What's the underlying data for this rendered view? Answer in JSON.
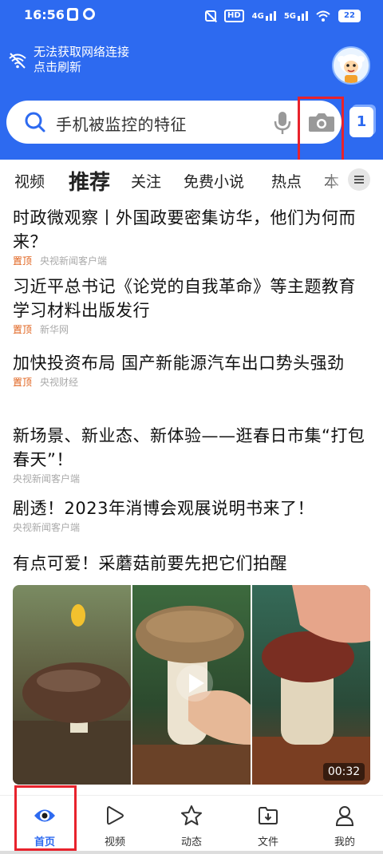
{
  "status_bar": {
    "time": "16:56",
    "network_hd": "HD",
    "signal1": "4G",
    "signal2": "5G",
    "battery": "22"
  },
  "header": {
    "offline_line1": "无法获取网络连接",
    "offline_line2": "点击刷新",
    "accent_color": "#2d6af0"
  },
  "search": {
    "query": "手机被监控的特征",
    "tab_count": "1",
    "icons": [
      "search-icon",
      "mic-icon",
      "camera-icon"
    ]
  },
  "category_tabs": [
    {
      "label": "视频",
      "active": false
    },
    {
      "label": "推荐",
      "active": true
    },
    {
      "label": "关注",
      "active": false
    },
    {
      "label": "免费小说",
      "active": false
    },
    {
      "label": "热点",
      "active": false
    },
    {
      "label": "本",
      "active": false
    }
  ],
  "news": [
    {
      "title": "时政微观察丨外国政要密集访华，他们为何而来？",
      "pinned": "置顶",
      "source": "央视新闻客户端"
    },
    {
      "title": "习近平总书记《论党的自我革命》等主题教育学习材料出版发行",
      "pinned": "置顶",
      "source": "新华网"
    },
    {
      "title": "加快投资布局 国产新能源汽车出口势头强劲",
      "pinned": "置顶",
      "source": "央视财经"
    },
    {
      "title": "新场景、新业态、新体验——逛春日市集“打包春天”！",
      "pinned": "",
      "source": "央视新闻客户端"
    },
    {
      "title": "剧透！2023年消博会观展说明书来了！",
      "pinned": "",
      "source": "央视新闻客户端"
    }
  ],
  "video": {
    "title": "有点可爱！采蘑菇前要先把它们拍醒",
    "duration": "00:32"
  },
  "bottom_nav": [
    {
      "label": "首页",
      "icon": "eye-icon",
      "active": true
    },
    {
      "label": "视频",
      "icon": "play-icon",
      "active": false
    },
    {
      "label": "动态",
      "icon": "star-icon",
      "active": false
    },
    {
      "label": "文件",
      "icon": "folder-icon",
      "active": false
    },
    {
      "label": "我的",
      "icon": "person-icon",
      "active": false
    }
  ]
}
